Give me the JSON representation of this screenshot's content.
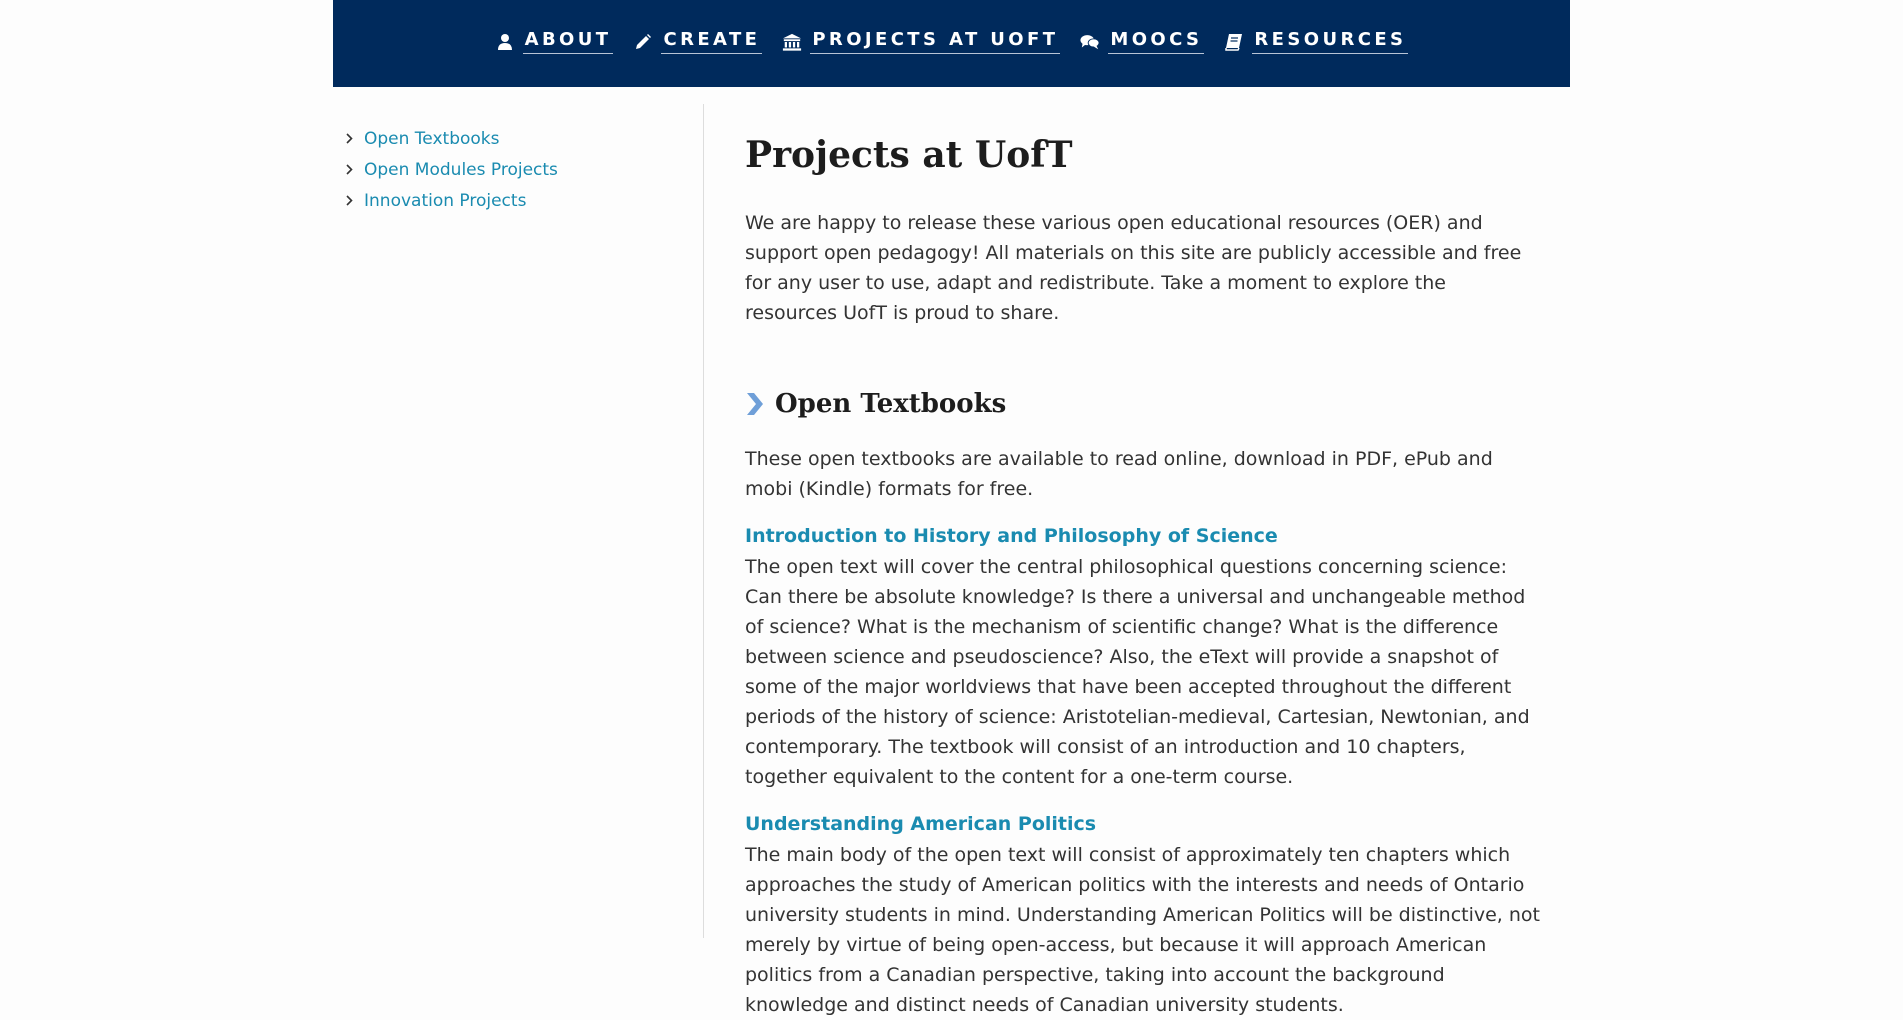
{
  "nav": {
    "items": [
      {
        "label": "ABOUT",
        "icon": "user-icon"
      },
      {
        "label": "CREATE",
        "icon": "pencil-icon"
      },
      {
        "label": "PROJECTS AT UOFT",
        "icon": "institution-icon"
      },
      {
        "label": "MOOCS",
        "icon": "comments-icon"
      },
      {
        "label": "RESOURCES",
        "icon": "book-icon"
      }
    ]
  },
  "sidebar": {
    "items": [
      {
        "label": "Open Textbooks"
      },
      {
        "label": "Open Modules Projects"
      },
      {
        "label": "Innovation Projects"
      }
    ]
  },
  "main": {
    "title": "Projects at UofT",
    "intro": "We are happy to release these various open educational resources (OER) and support open pedagogy! All materials on this site are publicly accessible and free for any user to use, adapt and redistribute. Take a moment to explore the resources UofT is proud to share.",
    "section": {
      "title": "Open Textbooks",
      "description": "These open textbooks are available to read online, download in PDF, ePub and mobi (Kindle) formats for free.",
      "projects": [
        {
          "title": "Introduction to History and Philosophy of Science",
          "body": "The open text will cover the central philosophical questions concerning science: Can there be absolute knowledge? Is there a universal and unchangeable method of science? What is the mechanism of scientific change? What is the difference between science and pseudoscience? Also, the eText will provide a snapshot of some of the major worldviews that have been accepted throughout the different periods of the history of science: Aristotelian-medieval, Cartesian, Newtonian, and contemporary. The textbook will consist of an introduction and 10 chapters, together equivalent to the content for a one-term course."
        },
        {
          "title": "Understanding American Politics",
          "body": "The main body of the open text will consist of approximately ten chapters which approaches the study of American politics with the interests and needs of Ontario university students in mind. Understanding American Politics will be distinctive, not merely by virtue of being open-access, but because it will approach American politics from a Canadian perspective, taking into account the background knowledge and distinct needs of Canadian university students."
        }
      ]
    }
  },
  "colors": {
    "header_bg": "#002a5c",
    "link": "#1a8bb0",
    "section_chevron": "#6f9fd8"
  }
}
